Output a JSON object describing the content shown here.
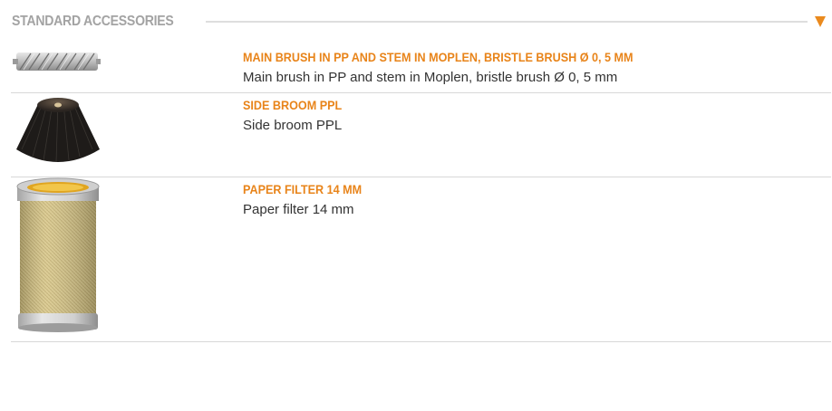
{
  "section": {
    "title": "STANDARD ACCESSORIES",
    "toggle_icon": "triangle-down-icon",
    "accent_color": "#e8841a"
  },
  "accessories": [
    {
      "title": "MAIN BRUSH IN PP AND STEM IN MOPLEN, BRISTLE BRUSH Ø 0, 5 MM",
      "description": "Main brush in PP and stem in Moplen, bristle brush Ø 0, 5 mm",
      "image": "main-brush-image"
    },
    {
      "title": "SIDE BROOM PPL",
      "description": "Side broom PPL",
      "image": "side-broom-image"
    },
    {
      "title": "PAPER FILTER 14 MM",
      "description": "Paper filter 14 mm",
      "image": "paper-filter-image"
    }
  ]
}
